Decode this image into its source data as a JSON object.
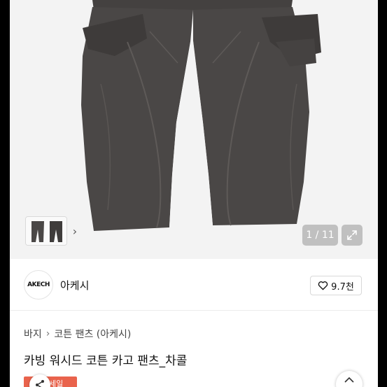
{
  "gallery": {
    "counter": "1 / 11",
    "thumb_arrow": "›",
    "expand_icon": "expand-icon"
  },
  "shop": {
    "logo_text": "AKECH",
    "name": "아케시",
    "likes": "9.7천"
  },
  "product": {
    "breadcrumb": [
      "바지",
      "코튼 팬츠 (아케시)"
    ],
    "breadcrumb_sep": "›",
    "title": "카빙 워시드 코튼 카고 팬츠_차콜",
    "sale_badge": "세일"
  },
  "colors": {
    "pants": "#4a4746",
    "sale": "#e9634c"
  }
}
